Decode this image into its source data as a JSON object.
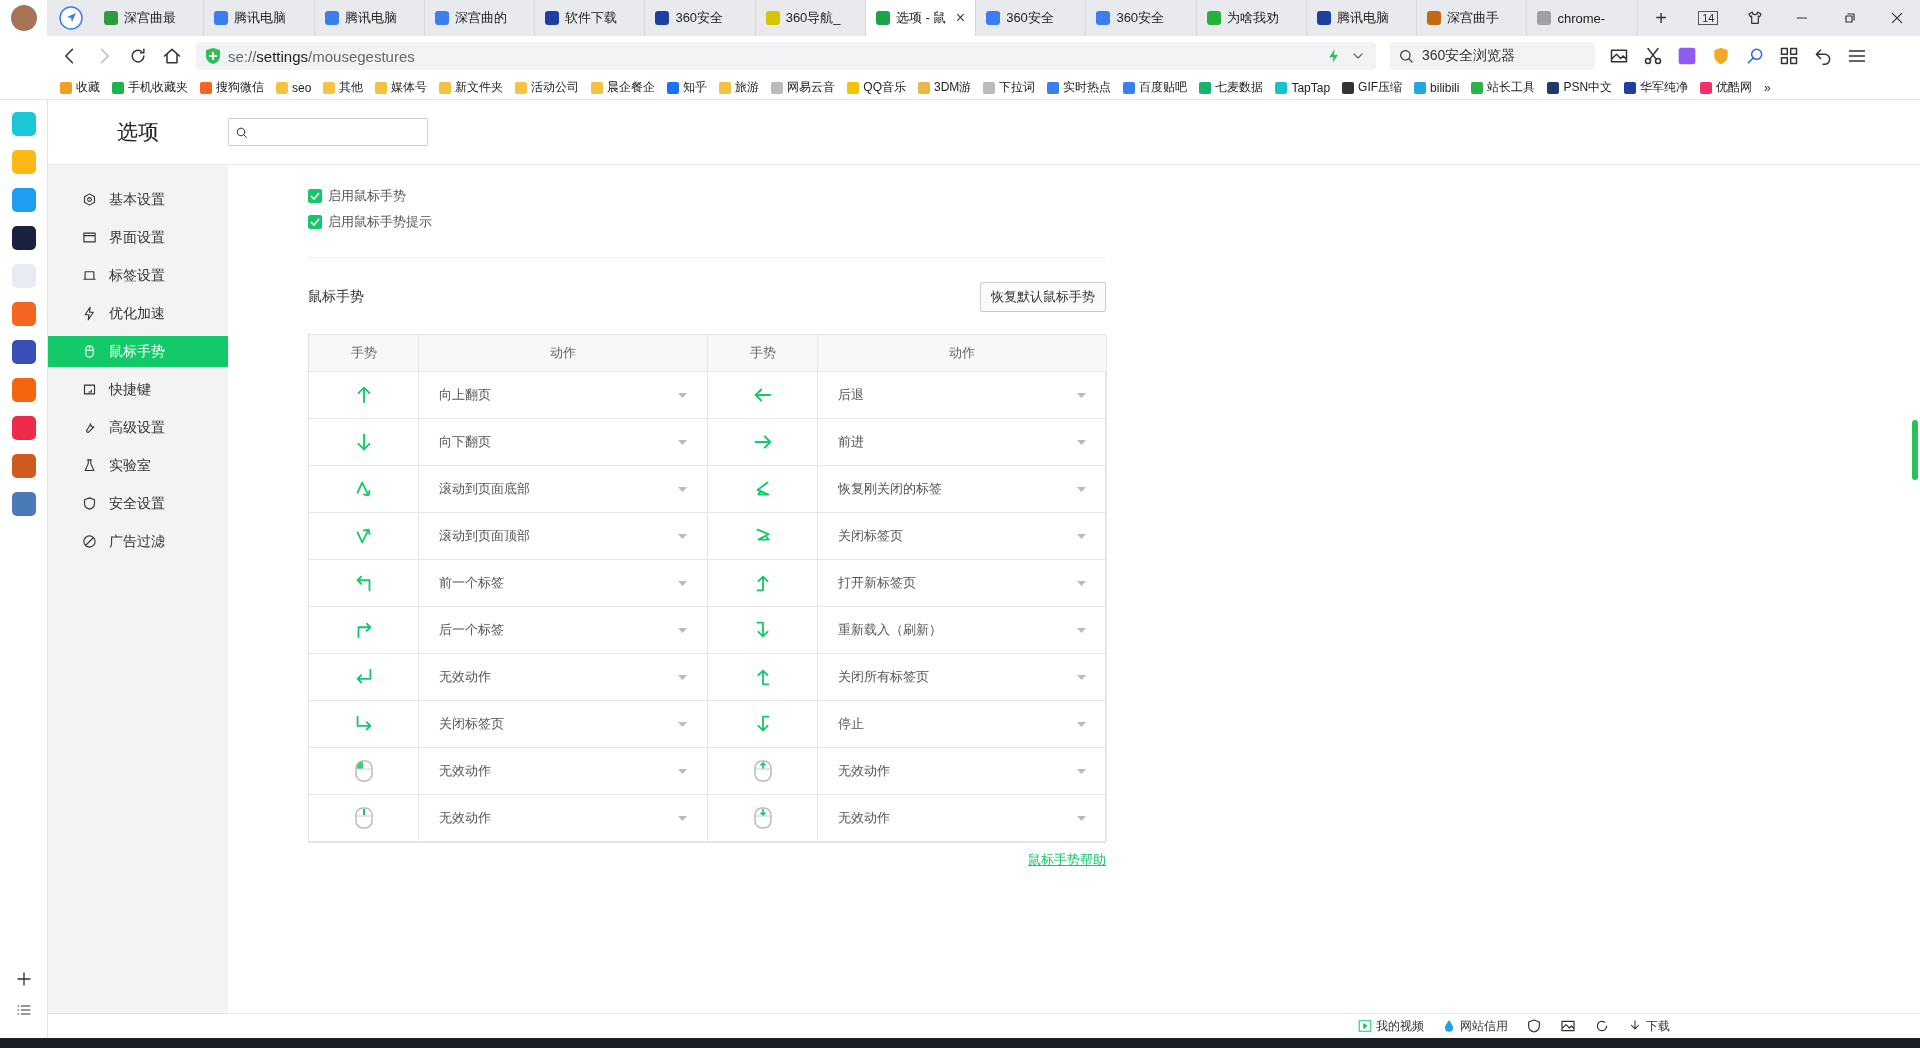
{
  "tabs": [
    {
      "title": "深宫曲最",
      "color": "#2e9b3c",
      "selected": false
    },
    {
      "title": "腾讯电脑",
      "color": "#3b7ef0",
      "selected": false
    },
    {
      "title": "腾讯电脑",
      "color": "#3b7ef0",
      "selected": false
    },
    {
      "title": "深宫曲的",
      "color": "#3b7ef0",
      "selected": false
    },
    {
      "title": "软件下载",
      "color": "#1d3fa0",
      "selected": false
    },
    {
      "title": "360安全",
      "color": "#1d3fa0",
      "selected": false
    },
    {
      "title": "360导航_",
      "color": "#d7c400",
      "selected": false
    },
    {
      "title": "选项 - 鼠",
      "color": "#1aa34a",
      "selected": true
    },
    {
      "title": "360安全",
      "color": "#3b7ef0",
      "selected": false
    },
    {
      "title": "360安全",
      "color": "#3b7ef0",
      "selected": false
    },
    {
      "title": "为啥我劝",
      "color": "#25b33a",
      "selected": false
    },
    {
      "title": "腾讯电脑",
      "color": "#1d3fa0",
      "selected": false
    },
    {
      "title": "深宫曲手",
      "color": "#c46a12",
      "selected": false
    },
    {
      "title": "chrome-",
      "color": "#a0a0a0",
      "selected": false
    }
  ],
  "close_tab": "×",
  "new_tab": "+",
  "tab_count": "14",
  "address": {
    "scheme": "se://",
    "host": "settings",
    "path": "/mousegestures"
  },
  "search": {
    "value": "360安全浏览器"
  },
  "bookmarks": [
    {
      "label": "收藏",
      "color": "#f0a020"
    },
    {
      "label": "手机收藏夹",
      "color": "#22b24c"
    },
    {
      "label": "搜狗微信",
      "color": "#f26522"
    },
    {
      "label": "seo",
      "color": "#f5c342"
    },
    {
      "label": "其他",
      "color": "#f5c342"
    },
    {
      "label": "媒体号",
      "color": "#f5c342"
    },
    {
      "label": "新文件夹",
      "color": "#f5c342"
    },
    {
      "label": "活动公司",
      "color": "#f5c342"
    },
    {
      "label": "晨企餐企",
      "color": "#f5c342"
    },
    {
      "label": "知乎",
      "color": "#1772f6"
    },
    {
      "label": "旅游",
      "color": "#f5c342"
    },
    {
      "label": "网易云音",
      "color": "#bbbbbb"
    },
    {
      "label": "QQ音乐",
      "color": "#f2c500"
    },
    {
      "label": "3DM游",
      "color": "#e8b84a"
    },
    {
      "label": "下拉词",
      "color": "#bbbbbb"
    },
    {
      "label": "实时热点",
      "color": "#3b7ef0"
    },
    {
      "label": "百度贴吧",
      "color": "#3b7ef0"
    },
    {
      "label": "七麦数据",
      "color": "#16b56f"
    },
    {
      "label": "TapTap",
      "color": "#16c3c9"
    },
    {
      "label": "GIF压缩",
      "color": "#333333"
    },
    {
      "label": "bilibili",
      "color": "#20a8e0"
    },
    {
      "label": "站长工具",
      "color": "#2db34a"
    },
    {
      "label": "PSN中文",
      "color": "#1e3a6a"
    },
    {
      "label": "华军纯净",
      "color": "#1d3fa0"
    },
    {
      "label": "优酷网",
      "color": "#f0306a"
    }
  ],
  "bookmarks_more": "»",
  "apps": [
    {
      "color": "#19c7d6"
    },
    {
      "color": "#fcb814"
    },
    {
      "color": "#1d9ef0"
    },
    {
      "color": "#1a2240"
    },
    {
      "color": "#e8ecf2"
    },
    {
      "color": "#f5651e"
    },
    {
      "color": "#3a4fb8"
    },
    {
      "color": "#f5650f"
    },
    {
      "color": "#f02a4a"
    },
    {
      "color": "#d05a20"
    },
    {
      "color": "#4a7ab8"
    }
  ],
  "page_title": "选项",
  "nav": [
    {
      "label": "基本设置",
      "selected": false
    },
    {
      "label": "界面设置",
      "selected": false
    },
    {
      "label": "标签设置",
      "selected": false
    },
    {
      "label": "优化加速",
      "selected": false
    },
    {
      "label": "鼠标手势",
      "selected": true
    },
    {
      "label": "快捷键",
      "selected": false
    },
    {
      "label": "高级设置",
      "selected": false
    },
    {
      "label": "实验室",
      "selected": false
    },
    {
      "label": "安全设置",
      "selected": false
    },
    {
      "label": "广告过滤",
      "selected": false
    }
  ],
  "options": [
    {
      "label": "启用鼠标手势",
      "checked": true
    },
    {
      "label": "启用鼠标手势提示",
      "checked": true
    }
  ],
  "section_title": "鼠标手势",
  "reset_button": "恢复默认鼠标手势",
  "table": {
    "columns": [
      "手势",
      "动作",
      "手势",
      "动作"
    ],
    "rows": [
      {
        "left": "向上翻页",
        "right": "后退"
      },
      {
        "left": "向下翻页",
        "right": "前进"
      },
      {
        "left": "滚动到页面底部",
        "right": "恢复刚关闭的标签"
      },
      {
        "left": "滚动到页面顶部",
        "right": "关闭标签页"
      },
      {
        "left": "前一个标签",
        "right": "打开新标签页"
      },
      {
        "left": "后一个标签",
        "right": "重新载入（刷新）"
      },
      {
        "left": "无效动作",
        "right": "关闭所有标签页"
      },
      {
        "left": "关闭标签页",
        "right": "停止"
      },
      {
        "left": "无效动作",
        "right": "无效动作"
      },
      {
        "left": "无效动作",
        "right": "无效动作"
      }
    ]
  },
  "help_link": "鼠标手势帮助",
  "status_bar": {
    "videos": "我的视频",
    "credit": "网站信用",
    "download": "下载"
  }
}
